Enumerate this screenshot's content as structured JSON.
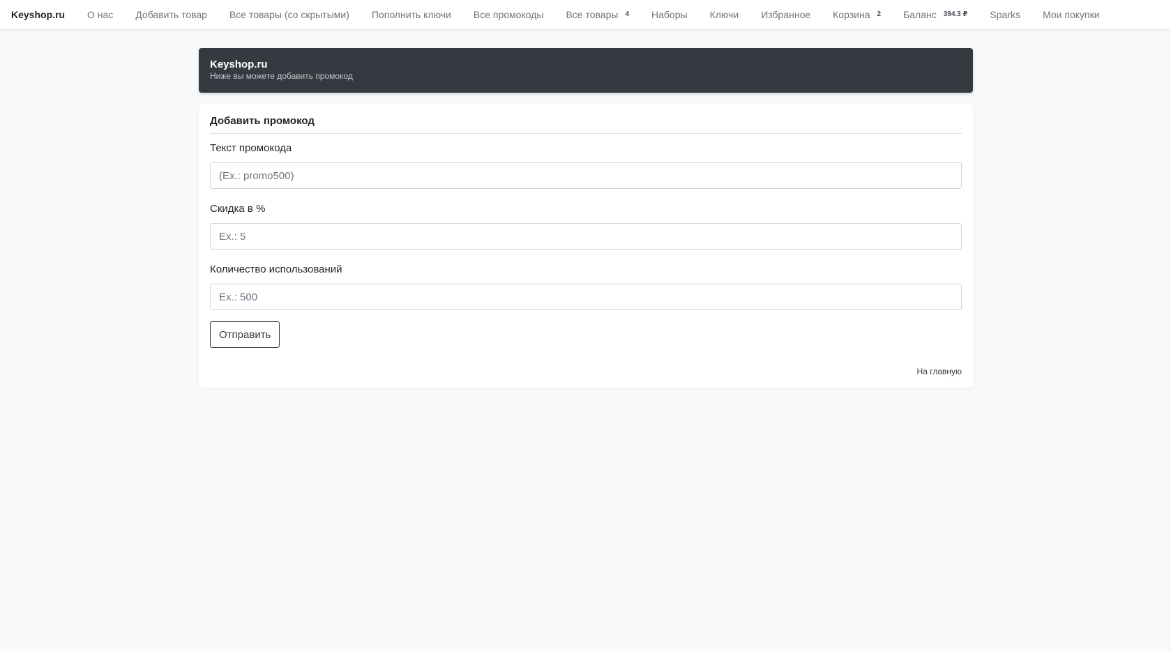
{
  "navbar": {
    "brand": "Keyshop.ru",
    "items": [
      {
        "label": "О нас"
      },
      {
        "label": "Добавить товар"
      },
      {
        "label": "Все товары (со скрытыми)"
      },
      {
        "label": "Пополнить ключи"
      },
      {
        "label": "Все промокоды"
      },
      {
        "label": "Все товары",
        "badge": "4"
      },
      {
        "label": "Наборы"
      },
      {
        "label": "Ключи"
      },
      {
        "label": "Избранное"
      },
      {
        "label": "Корзина",
        "badge": "2"
      },
      {
        "label": "Баланс",
        "badge": "394.3 ₽"
      },
      {
        "label": "Sparks"
      },
      {
        "label": "Мои покупки"
      }
    ]
  },
  "header": {
    "title": "Keyshop.ru",
    "subtitle": "Ниже вы можете добавить промокод"
  },
  "form": {
    "title": "Добавить промокод",
    "fields": [
      {
        "label": "Текст промокода",
        "placeholder": "(Ex.: promo500)",
        "value": ""
      },
      {
        "label": "Скидка в %",
        "placeholder": "Ex.: 5",
        "value": ""
      },
      {
        "label": "Количество использований",
        "placeholder": "Ex.: 500",
        "value": ""
      }
    ],
    "submit_label": "Отправить",
    "home_link": "На главную"
  }
}
